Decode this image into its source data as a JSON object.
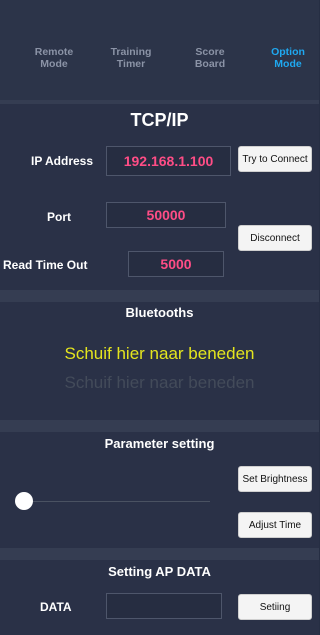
{
  "nav": {
    "tabs": [
      {
        "label": "Remote\nMode",
        "active": false
      },
      {
        "label": "Training\nTimer",
        "active": false
      },
      {
        "label": "Score\nBoard",
        "active": false
      },
      {
        "label": "Option\nMode",
        "active": true
      }
    ]
  },
  "tcp": {
    "title": "TCP/IP",
    "ip_label": "IP Address",
    "ip_value": "192.168.1.100",
    "port_label": "Port",
    "port_value": "50000",
    "timeout_label": "Read Time Out",
    "timeout_value": "5000",
    "connect_button": "Try to Connect",
    "disconnect_button": "Disconnect"
  },
  "bluetooth": {
    "title": "Bluetooths",
    "hint_primary": "Schuif hier naar beneden",
    "hint_secondary": "Schuif hier naar beneden"
  },
  "parameter": {
    "title": "Parameter setting",
    "brightness_button": "Set Brightness",
    "adjust_time_button": "Adjust Time",
    "slider_level": 0
  },
  "ap": {
    "title": "Setting AP DATA",
    "data_label": "DATA",
    "data_value": "",
    "setting_button": "Setiing"
  },
  "colors": {
    "background": "#262e43",
    "accent": "#1fa8f0",
    "value_text": "#ff4d86",
    "hint": "#e4e51e"
  }
}
